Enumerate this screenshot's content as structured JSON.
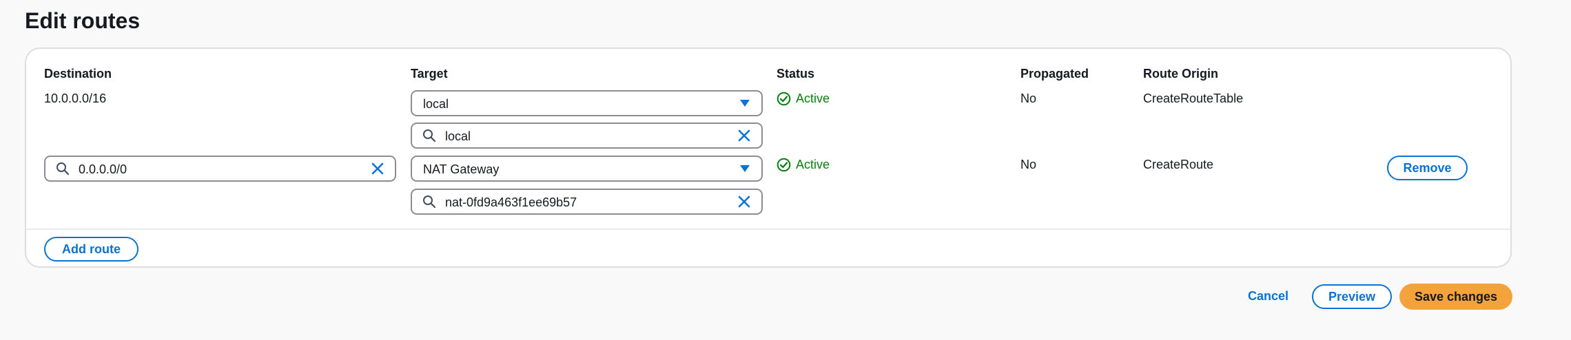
{
  "page": {
    "title": "Edit routes"
  },
  "table": {
    "headers": {
      "destination": "Destination",
      "target": "Target",
      "status": "Status",
      "propagated": "Propagated",
      "route_origin": "Route Origin"
    },
    "rows": [
      {
        "destination": "10.0.0.0/16",
        "target_type": "local",
        "target_search": "local",
        "status": "Active",
        "propagated": "No",
        "route_origin": "CreateRouteTable"
      },
      {
        "destination": "0.0.0.0/0",
        "target_type": "NAT Gateway",
        "target_search": "nat-0fd9a463f1ee69b57",
        "status": "Active",
        "propagated": "No",
        "route_origin": "CreateRoute",
        "remove_label": "Remove"
      }
    ],
    "add_route_label": "Add route"
  },
  "footer": {
    "cancel_label": "Cancel",
    "preview_label": "Preview",
    "save_label": "Save changes"
  },
  "icons": {
    "search": "search-icon",
    "clear": "close-icon",
    "dropdown": "caret-down-icon",
    "status": "check-circle-icon"
  },
  "colors": {
    "accent": "#0972d3",
    "success": "#037f0c",
    "primary_button": "#f4a23c",
    "border": "#8c8c94"
  }
}
